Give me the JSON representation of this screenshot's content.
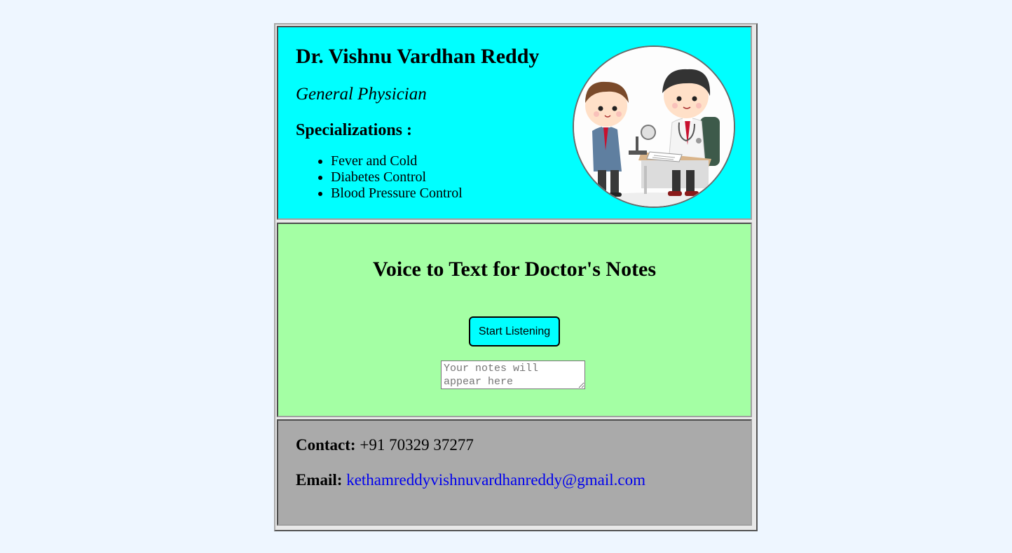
{
  "profile": {
    "name": "Dr. Vishnu Vardhan Reddy",
    "role": "General Physician",
    "specializations_title": "Specializations :",
    "specializations": [
      "Fever and Cold",
      "Diabetes Control",
      "Blood Pressure Control"
    ],
    "avatar_icon": "doctor-patient-illustration"
  },
  "voice": {
    "title": "Voice to Text for Doctor's Notes",
    "button_label": "Start Listening",
    "notes_placeholder": "Your notes will appear here",
    "notes_value": ""
  },
  "contact": {
    "contact_label": "Contact:",
    "phone": "+91 70329 37277",
    "email_label": "Email:",
    "email": "kethamreddyvishnuvardhanreddy@gmail.com"
  },
  "colors": {
    "profile_bg": "#00ffff",
    "voice_bg": "#a4ffa4",
    "contact_bg": "#aaaaaa",
    "page_bg": "#eef6ff",
    "link": "#0000ee"
  }
}
